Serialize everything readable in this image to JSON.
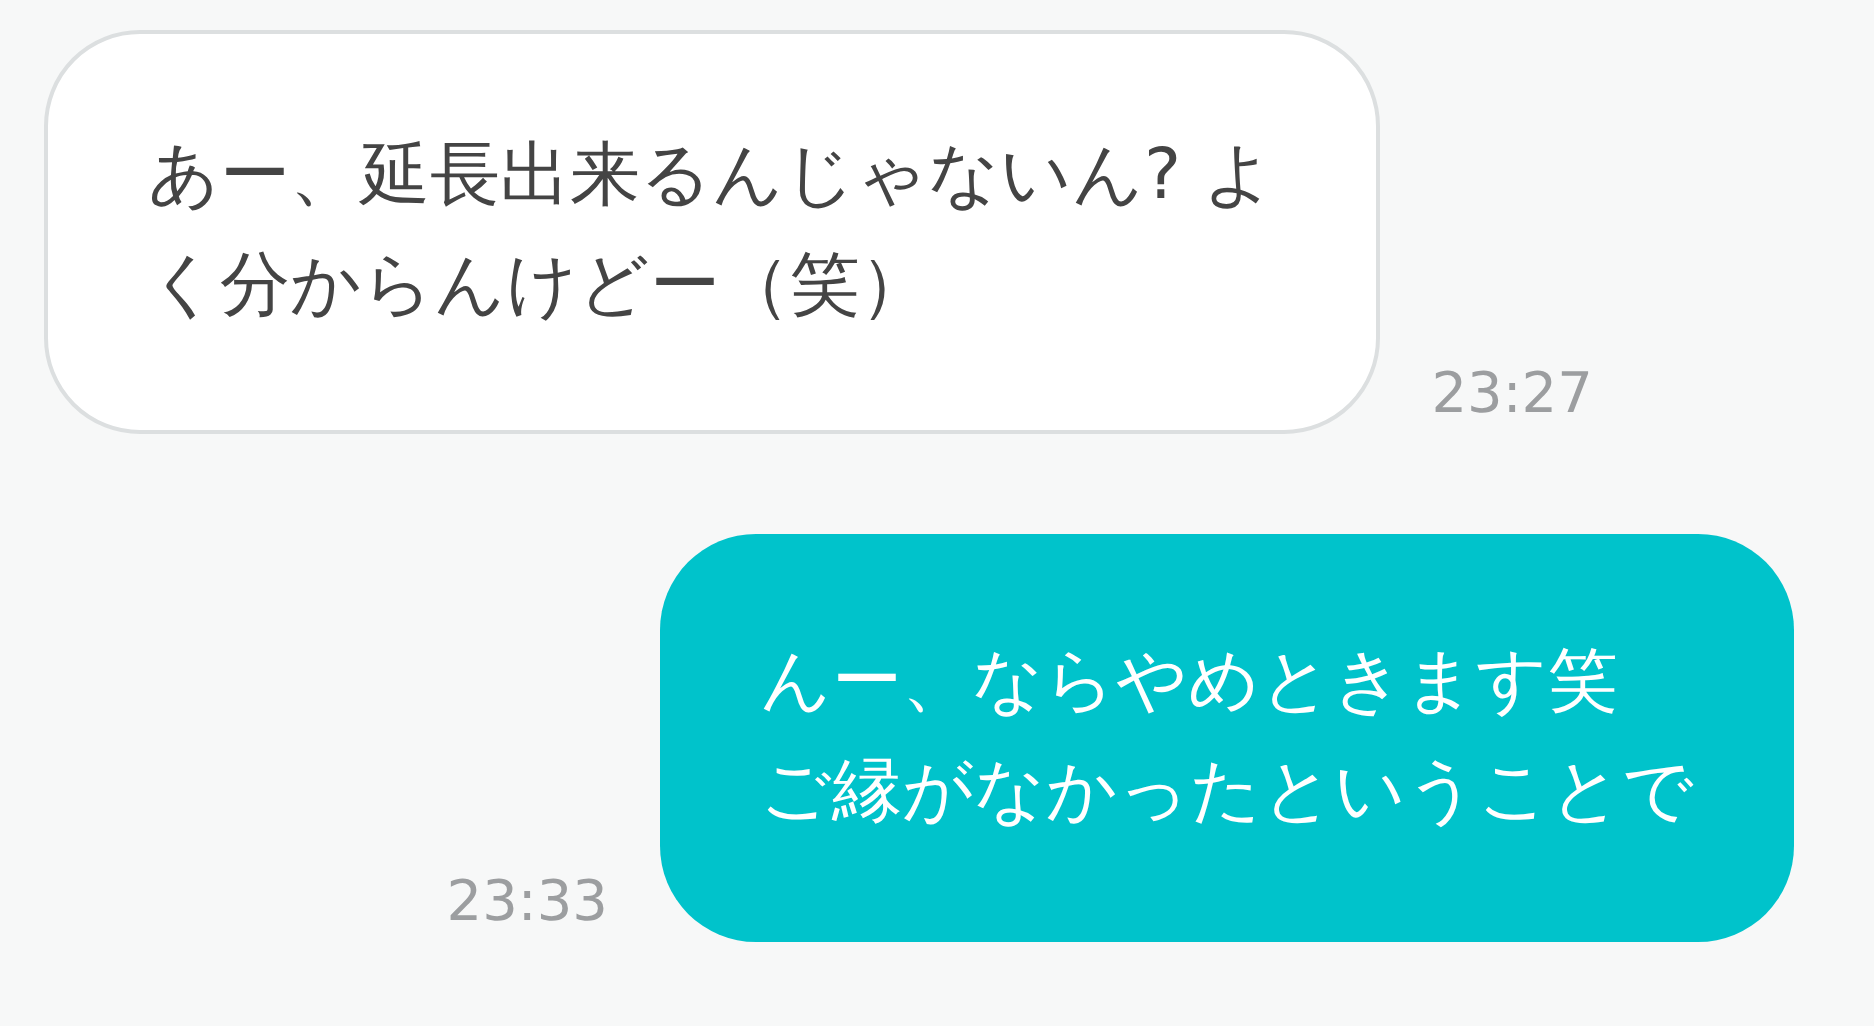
{
  "messages": [
    {
      "kind": "incoming",
      "lines": [
        "あー、延長出来るんじゃないん? よ",
        "く分からんけどー（笑）"
      ],
      "time": "23:27"
    },
    {
      "kind": "outgoing",
      "lines": [
        "んー、ならやめときます笑",
        "ご縁がなかったということで"
      ],
      "time": "23:33"
    }
  ]
}
